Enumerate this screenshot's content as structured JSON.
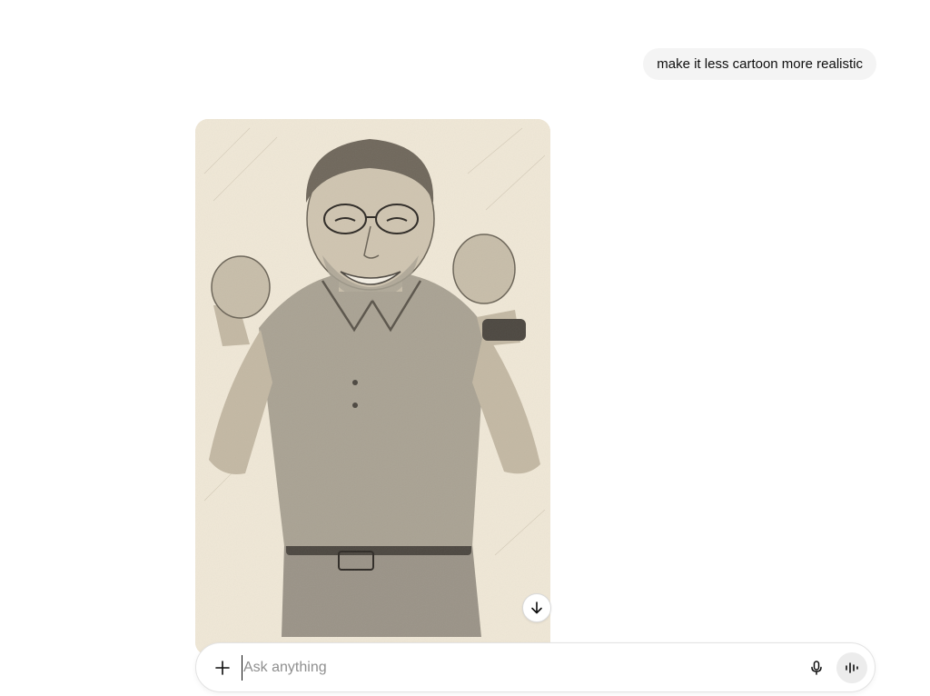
{
  "conversation": {
    "user_message": "make it less cartoon more realistic"
  },
  "generated_image": {
    "subject": "pencil sketch of a smiling older man with glasses raising both fists",
    "background_color": "#efe7d6",
    "download_icon": "arrow-down-icon"
  },
  "composer": {
    "placeholder": "Ask anything",
    "value": "",
    "plus_icon": "plus-icon",
    "mic_icon": "microphone-icon",
    "voice_icon": "voice-mode-icon"
  },
  "colors": {
    "bubble_bg": "#f4f4f4",
    "voice_button_bg": "#ececec",
    "text": "#0d0d0d",
    "placeholder": "#8f8f8f"
  }
}
